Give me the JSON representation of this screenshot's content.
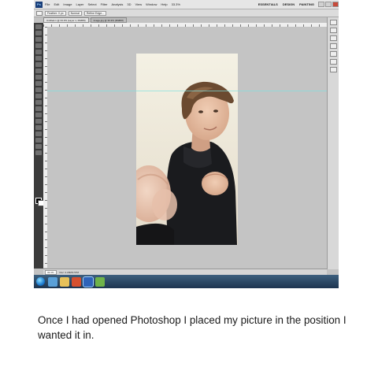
{
  "menubar": {
    "logo": "Ps",
    "items": [
      "File",
      "Edit",
      "Image",
      "Layer",
      "Select",
      "Filter",
      "Analysis",
      "3D",
      "View",
      "Window",
      "Help"
    ],
    "zoom": "33.3%",
    "workspaces": [
      "ESSENTIALS",
      "DESIGN",
      "PAINTING"
    ]
  },
  "options_bar": {
    "feather": "Feather: 0 px",
    "style": "Normal",
    "refine": "Refine Edge..."
  },
  "tabs": [
    {
      "label": "Untitled-1 @ 33.3% (Layer 1, RGB/8)"
    },
    {
      "label": "Image.jpg @ 33.3% (RGB/8)"
    }
  ],
  "status": {
    "zoom": "33.3%",
    "doc": "Doc: 2.29M/4.57M"
  },
  "caption": "Once I had opened Photoshop I placed my picture in the position I wanted it in.",
  "colors": {
    "canvas_bg": "#c4c4c4",
    "taskbar": "#1d3550",
    "guide": "#7fe0e0"
  }
}
